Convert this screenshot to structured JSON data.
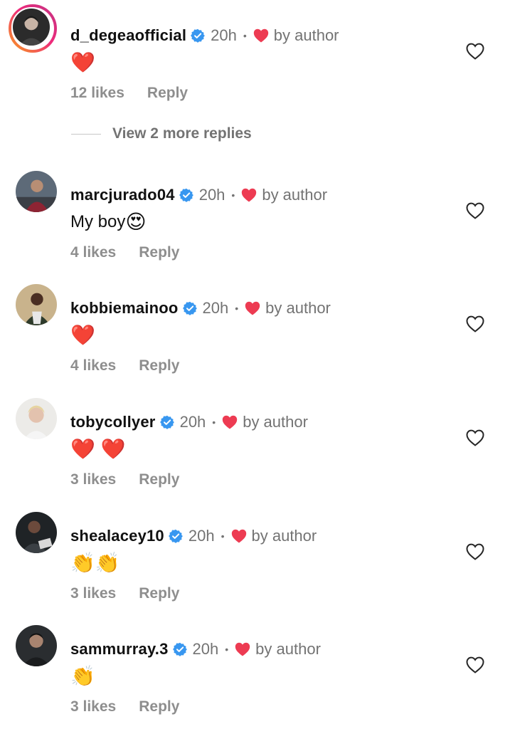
{
  "comments": [
    {
      "username": "d_degeaofficial",
      "time": "20h",
      "separator": "•",
      "by_author": "by author",
      "text": "",
      "emoji": "❤️",
      "likes": "12 likes",
      "reply": "Reply",
      "avatar_bg": "#2b2b2b"
    },
    {
      "username": "marcjurado04",
      "time": "20h",
      "separator": "•",
      "by_author": "by author",
      "text": "My boy",
      "emoji": "😍",
      "likes": "4 likes",
      "reply": "Reply",
      "avatar_bg": "#7b2e3a"
    },
    {
      "username": "kobbiemainoo",
      "time": "20h",
      "separator": "•",
      "by_author": "by author",
      "text": "",
      "emoji": "❤️",
      "likes": "4 likes",
      "reply": "Reply",
      "avatar_bg": "#3d4a3a"
    },
    {
      "username": "tobycollyer",
      "time": "20h",
      "separator": "•",
      "by_author": "by author",
      "text": "",
      "emoji": "❤️ ❤️",
      "likes": "3 likes",
      "reply": "Reply",
      "avatar_bg": "#d9d4cd"
    },
    {
      "username": "shealacey10",
      "time": "20h",
      "separator": "•",
      "by_author": "by author",
      "text": "",
      "emoji": "👏👏",
      "likes": "3 likes",
      "reply": "Reply",
      "avatar_bg": "#1f2326"
    },
    {
      "username": "sammurray.3",
      "time": "20h",
      "separator": "•",
      "by_author": "by author",
      "text": "",
      "emoji": "👏",
      "likes": "3 likes",
      "reply": "Reply",
      "avatar_bg": "#2a2d30"
    }
  ],
  "view_more_replies": "View 2 more replies",
  "colors": {
    "verified": "#3897f0",
    "heart": "#ed3b52",
    "muted": "#737373",
    "story_ring_start": "#f9a11b",
    "story_ring_end": "#c13584"
  },
  "icons": {
    "verified": "verified-badge-icon",
    "author_heart": "heart-filled-icon",
    "like": "heart-outline-icon"
  }
}
